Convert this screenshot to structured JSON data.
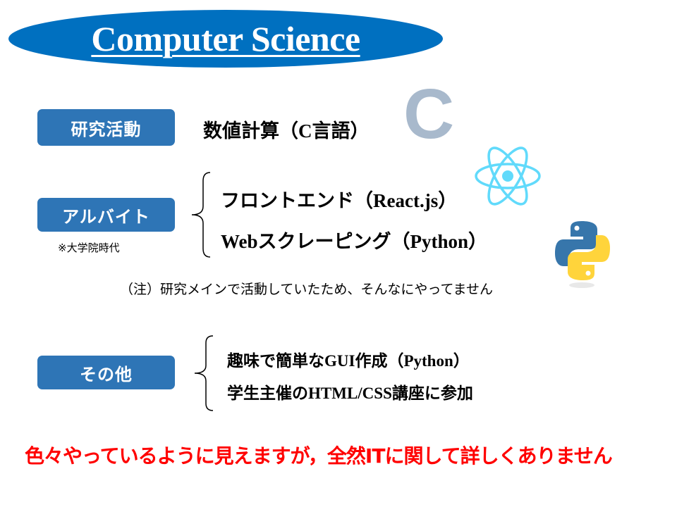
{
  "title": "Computer Science",
  "sections": [
    {
      "label": "研究活動",
      "items": [
        "数値計算（C言語）"
      ]
    },
    {
      "label": "アルバイト",
      "sublabel": "※大学院時代",
      "items": [
        "フロントエンド（React.js）",
        "Webスクレーピング（Python）"
      ]
    },
    {
      "label": "その他",
      "items": [
        "趣味で簡単なGUI作成（Python）",
        "学生主催のHTML/CSS講座に参加"
      ]
    }
  ],
  "note": "（注）研究メインで活動していたため、そんなにやってません",
  "conclusion": "色々やっているように見えますが，全然ITに関して詳しくありません",
  "logos": {
    "c": "C",
    "react": "react-icon",
    "python": "python-icon"
  },
  "colors": {
    "title_bg": "#0070c0",
    "label_bg": "#2e75b6",
    "conclusion": "#ff0000",
    "react": "#61dafb",
    "c_logo": "#a8b9cc"
  }
}
